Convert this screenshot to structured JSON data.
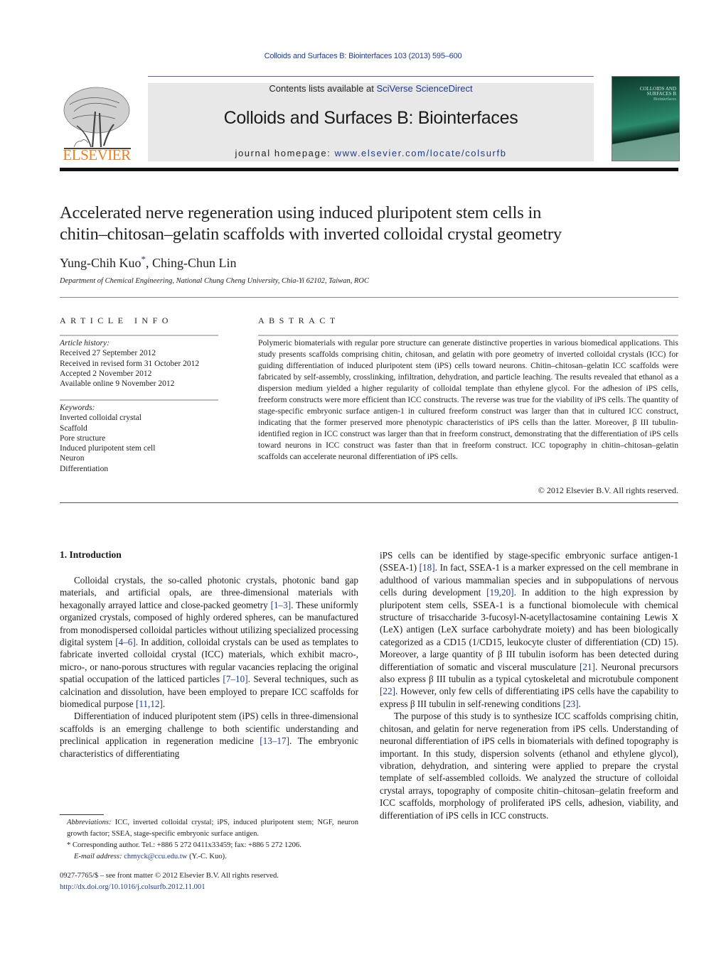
{
  "running_head": "Colloids and Surfaces B: Biointerfaces 103 (2013) 595–600",
  "masthead": {
    "publisher_logo_text": "ELSEVIER",
    "contents_prefix": "Contents lists available at ",
    "contents_link": "SciVerse ScienceDirect",
    "journal_title": "Colloids and Surfaces B: Biointerfaces",
    "homepage_prefix": "journal homepage: ",
    "homepage_link": "www.elsevier.com/locate/colsurfb",
    "cover_title": "COLLOIDS AND SURFACES B",
    "cover_subtitle": "Biointerfaces",
    "colors": {
      "publisher_orange": "#f07d1e",
      "link_blue": "#1f3a8c",
      "masthead_gray": "#e8e8e8"
    }
  },
  "article": {
    "title_line1": "Accelerated nerve regeneration using induced pluripotent stem cells in",
    "title_line2": "chitin–chitosan–gelatin scaffolds with inverted colloidal crystal geometry",
    "authors": [
      {
        "name": "Yung-Chih Kuo",
        "marker": "*"
      },
      {
        "name": "Ching-Chun Lin",
        "marker": ""
      }
    ],
    "author_separator": ", ",
    "affiliation": "Department of Chemical Engineering, National Chung Cheng University, Chia-Yi 62102, Taiwan, ROC"
  },
  "article_info": {
    "heading": "ARTICLE INFO",
    "history_label": "Article history:",
    "history": [
      "Received 27 September 2012",
      "Received in revised form 31 October 2012",
      "Accepted 2 November 2012",
      "Available online 9 November 2012"
    ],
    "keywords_label": "Keywords:",
    "keywords": [
      "Inverted colloidal crystal",
      "Scaffold",
      "Pore structure",
      "Induced pluripotent stem cell",
      "Neuron",
      "Differentiation"
    ]
  },
  "abstract": {
    "heading": "ABSTRACT",
    "text": "Polymeric biomaterials with regular pore structure can generate distinctive properties in various biomedical applications. This study presents scaffolds comprising chitin, chitosan, and gelatin with pore geometry of inverted colloidal crystals (ICC) for guiding differentiation of induced pluripotent stem (iPS) cells toward neurons. Chitin–chitosan–gelatin ICC scaffolds were fabricated by self-assembly, crosslinking, infiltration, dehydration, and particle leaching. The results revealed that ethanol as a dispersion medium yielded a higher regularity of colloidal template than ethylene glycol. For the adhesion of iPS cells, freeform constructs were more efficient than ICC constructs. The reverse was true for the viability of iPS cells. The quantity of stage-specific embryonic surface antigen-1 in cultured freeform construct was larger than that in cultured ICC construct, indicating that the former preserved more phenotypic characteristics of iPS cells than the latter. Moreover, β III tubulin-identified region in ICC construct was larger than that in freeform construct, demonstrating that the differentiation of iPS cells toward neurons in ICC construct was faster than that in freeform construct. ICC topography in chitin–chitosan–gelatin scaffolds can accelerate neuronal differentiation of iPS cells.",
    "copyright": "© 2012 Elsevier B.V. All rights reserved."
  },
  "introduction": {
    "heading": "1.  Introduction",
    "left_paragraphs": [
      [
        {
          "t": "Colloidal crystals, the so-called photonic crystals, photonic band gap materials, and artificial opals, are three-dimensional materials with hexagonally arrayed lattice and close-packed geometry "
        },
        {
          "t": "[1–3]",
          "ref": true
        },
        {
          "t": ". These uniformly organized crystals, composed of highly ordered spheres, can be manufactured from monodispersed colloidal particles without utilizing specialized processing digital system "
        },
        {
          "t": "[4–6]",
          "ref": true
        },
        {
          "t": ". In addition, colloidal crystals can be used as templates to fabricate inverted colloidal crystal (ICC) materials, which exhibit macro-, micro-, or nano-porous structures with regular vacancies replacing the original spatial occupation of the latticed particles "
        },
        {
          "t": "[7–10]",
          "ref": true
        },
        {
          "t": ". Several techniques, such as calcination and dissolution, have been employed to prepare ICC scaffolds for biomedical purpose "
        },
        {
          "t": "[11,12]",
          "ref": true
        },
        {
          "t": "."
        }
      ],
      [
        {
          "t": "Differentiation of induced pluripotent stem (iPS) cells in three-dimensional scaffolds is an emerging challenge to both scientific understanding and preclinical application in regeneration medicine "
        },
        {
          "t": "[13–17]",
          "ref": true
        },
        {
          "t": ". The embryonic characteristics of differentiating"
        }
      ]
    ],
    "right_paragraphs": [
      [
        {
          "t": "iPS cells can be identified by stage-specific embryonic surface antigen-1 (SSEA-1) "
        },
        {
          "t": "[18]",
          "ref": true
        },
        {
          "t": ". In fact, SSEA-1 is a marker expressed on the cell membrane in adulthood of various mammalian species and in subpopulations of nervous cells during development "
        },
        {
          "t": "[19,20]",
          "ref": true
        },
        {
          "t": ". In addition to the high expression by pluripotent stem cells, SSEA-1 is a functional biomolecule with chemical structure of trisaccharide 3-fucosyl-N-acetyllactosamine containing Lewis X (LeX) antigen (LeX surface carbohydrate moiety) and has been biologically categorized as a CD15 (1/CD15, leukocyte cluster of differentiation (CD) 15). Moreover, a large quantity of β III tubulin isoform has been detected during differentiation of somatic and visceral musculature "
        },
        {
          "t": "[21]",
          "ref": true
        },
        {
          "t": ". Neuronal precursors also express β III tubulin as a typical cytoskeletal and microtubule component "
        },
        {
          "t": "[22]",
          "ref": true
        },
        {
          "t": ". However, only few cells of differentiating iPS cells have the capability to express β III tubulin in self-renewing conditions "
        },
        {
          "t": "[23]",
          "ref": true
        },
        {
          "t": "."
        }
      ],
      [
        {
          "t": "The purpose of this study is to synthesize ICC scaffolds comprising chitin, chitosan, and gelatin for nerve regeneration from iPS cells. Understanding of neuronal differentiation of iPS cells in biomaterials with defined topography is important. In this study, dispersion solvents (ethanol and ethylene glycol), vibration, dehydration, and sintering were applied to prepare the crystal template of self-assembled colloids. We analyzed the structure of colloidal crystal arrays, topography of composite chitin–chitosan–gelatin freeform and ICC scaffolds, morphology of proliferated iPS cells, adhesion, viability, and differentiation of iPS cells in ICC constructs."
        }
      ]
    ]
  },
  "footnotes": {
    "abbreviations_label": "Abbreviations:",
    "abbreviations_text": "  ICC, inverted colloidal crystal; iPS, induced pluripotent stem; NGF, neuron growth factor; SSEA, stage-specific embryonic surface antigen.",
    "corresponding": "* Corresponding author. Tel.: +886 5 272 0411x33459; fax: +886 5 272 1206.",
    "email_label": "E-mail address: ",
    "email": "chmyck@ccu.edu.tw",
    "email_suffix": " (Y.-C. Kuo)."
  },
  "front_matter": {
    "issn_line": "0927-7765/$ – see front matter © 2012 Elsevier B.V. All rights reserved.",
    "doi": "http://dx.doi.org/10.1016/j.colsurfb.2012.11.001"
  }
}
